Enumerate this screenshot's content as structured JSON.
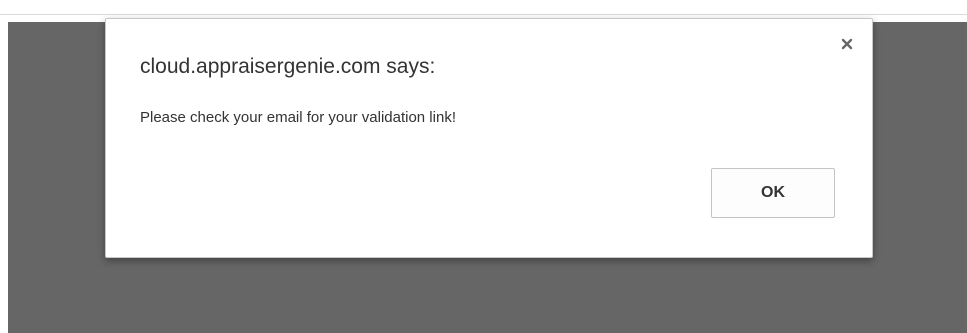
{
  "dialog": {
    "title": "cloud.appraisergenie.com says:",
    "message": "Please check your email for your validation link!",
    "ok_label": "OK",
    "close_icon": "close-icon"
  },
  "colors": {
    "overlay": "#666666",
    "dialog_background": "#ffffff",
    "text": "#333333"
  }
}
